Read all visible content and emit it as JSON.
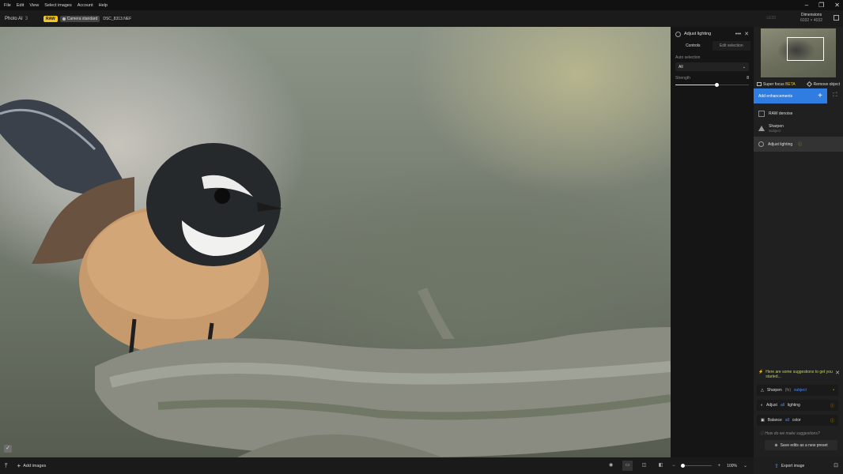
{
  "menu": [
    "File",
    "Edit",
    "View",
    "Select images",
    "Account",
    "Help"
  ],
  "window_controls": {
    "minimize": "–",
    "maximize": "❐",
    "close": "✕"
  },
  "app": {
    "name": "Photo AI",
    "version": "3"
  },
  "badges": {
    "raw": "RAW",
    "camera": "Camera standard"
  },
  "file_name": "DSC_8313.NEF",
  "zoom_tag": "LE33",
  "dimensions": {
    "label": "Dimensions",
    "value": "6032 × 4032"
  },
  "controls_panel": {
    "title": "Adjust lighting",
    "more": "•••",
    "close": "✕",
    "tabs": [
      "Controls",
      "Edit selection"
    ],
    "auto_selection_label": "Auto selection",
    "auto_selection_value": "All",
    "strength_label": "Strength",
    "strength_value": "8",
    "strength_fraction": 0.56
  },
  "side": {
    "super_focus": "Super focus",
    "super_focus_badge": "BETA",
    "remove_object": "Remove object",
    "add_enhancements": "Add enhancements",
    "enhancements": [
      {
        "name": "RAW denoise",
        "sub": "",
        "icon": "raw-denoise-icon"
      },
      {
        "name": "Sharpen",
        "sub": "Subject",
        "icon": "sharpen-icon"
      },
      {
        "name": "Adjust lighting",
        "sub": "",
        "icon": "lighting-icon",
        "warn": "ⓘ"
      }
    ],
    "suggestions_title": "Here are some suggestions to get you started...",
    "suggestions": [
      {
        "pre": "Sharpen",
        "mid": "(fx)",
        "post": "subject",
        "tail": "•"
      },
      {
        "pre": "Adjust",
        "mid": "all",
        "post": "lighting",
        "tail": "ⓘ"
      },
      {
        "pre": "Balance",
        "mid": "all",
        "post": "color",
        "tail": "ⓘ"
      }
    ],
    "how_link": "How do we make suggestions?",
    "save_preset": "Save edits as a new preset"
  },
  "bottom": {
    "add_images": "Add images",
    "zoom": "100%",
    "zoom_fraction": 0.05
  },
  "export": {
    "label": "Export image"
  },
  "accent_colors": {
    "blue": "#2f7de1",
    "raw_badge": "#f5c518",
    "suggestion": "#c2d44a"
  }
}
